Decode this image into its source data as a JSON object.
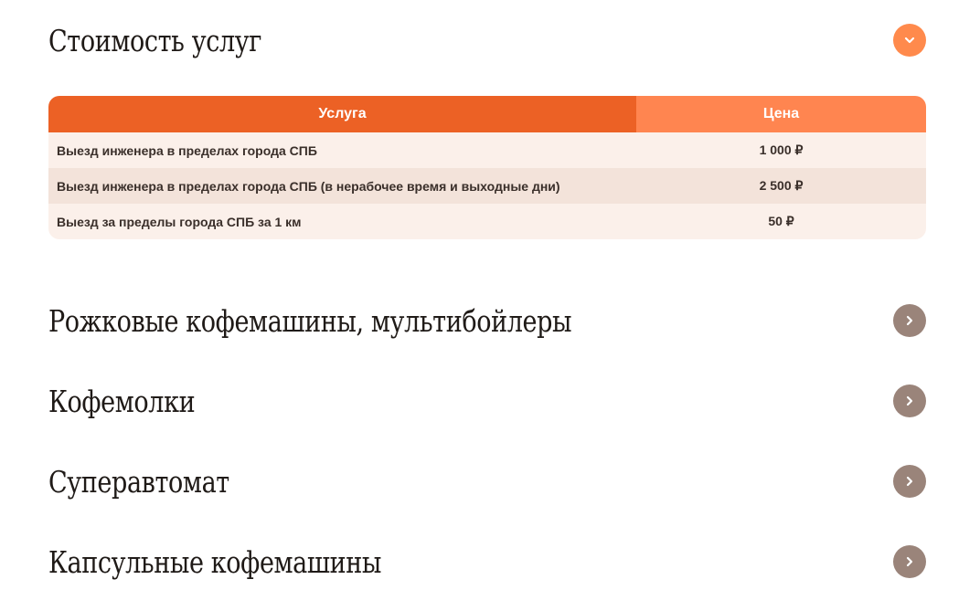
{
  "sections": [
    {
      "title": "Стоимость услуг",
      "state": "open"
    },
    {
      "title": "Рожковые кофемашины, мультибойлеры",
      "state": "closed"
    },
    {
      "title": "Кофемолки",
      "state": "closed"
    },
    {
      "title": "Суперавтомат",
      "state": "closed"
    },
    {
      "title": "Капсульные кофемашины",
      "state": "closed"
    }
  ],
  "price_table": {
    "headers": {
      "service": "Услуга",
      "price": "Цена"
    },
    "rows": [
      {
        "service": "Выезд инженера в пределах города СПБ",
        "price": "1 000 ₽"
      },
      {
        "service": "Выезд инженера в пределах города СПБ (в нерабочее время и выходные дни)",
        "price": "2 500 ₽"
      },
      {
        "service": "Выезд за пределы города СПБ за 1 км",
        "price": "50 ₽"
      }
    ]
  },
  "icons": {
    "open": "chevron-down-icon",
    "closed": "chevron-right-icon"
  },
  "colors": {
    "accent": "#ec6125",
    "accent_light": "#ff8550",
    "toggle_open": "#ff8a4c",
    "toggle_closed": "#9a847a",
    "row_odd": "#fbf0ea",
    "row_even": "#f3e3da"
  }
}
